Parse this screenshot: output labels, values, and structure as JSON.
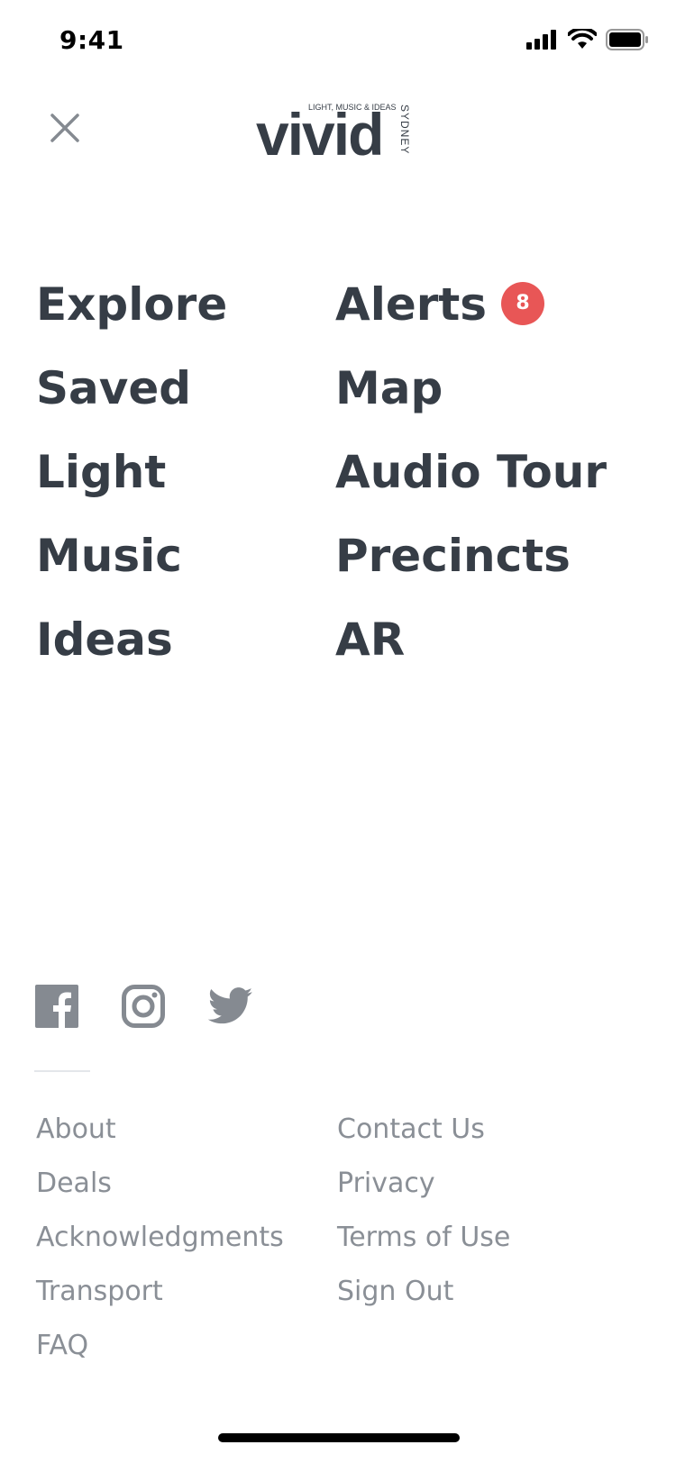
{
  "status_bar": {
    "time": "9:41"
  },
  "header": {
    "logo": {
      "wordmark": "vivid",
      "tagline": "LIGHT, MUSIC & IDEAS",
      "location": "SYDNEY"
    }
  },
  "nav": {
    "left": [
      "Explore",
      "Saved",
      "Light",
      "Music",
      "Ideas"
    ],
    "right": [
      "Alerts",
      "Map",
      "Audio Tour",
      "Precincts",
      "AR"
    ],
    "alerts_count": "8"
  },
  "social": {
    "icons": [
      "facebook-icon",
      "instagram-icon",
      "twitter-icon"
    ]
  },
  "footer": {
    "left": [
      "About",
      "Deals",
      "Acknowledgments",
      "Transport",
      "FAQ"
    ],
    "right": [
      "Contact Us",
      "Privacy",
      "Terms of Use",
      "Sign Out"
    ]
  },
  "colors": {
    "text": "#363d46",
    "muted": "#8a8f96",
    "badge": "#e85656",
    "icon": "#858a91"
  }
}
